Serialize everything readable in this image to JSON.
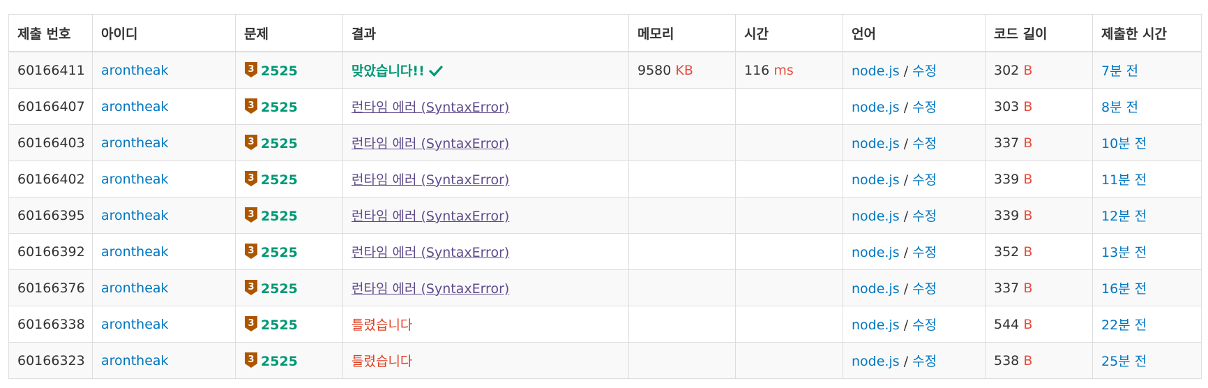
{
  "headers": [
    "제출 번호",
    "아이디",
    "문제",
    "결과",
    "메모리",
    "시간",
    "언어",
    "코드 길이",
    "제출한 시간"
  ],
  "edit_label": "수정",
  "lang_sep": "/",
  "problem_tier": "3",
  "colors": {
    "link_blue": "#0076c0",
    "accepted_green": "#009874",
    "wrong_red": "#dd4124",
    "unit_red": "#e74c3c",
    "runtime_error_purple": "#5f4b8b",
    "bronze_badge": "#ad5600"
  },
  "rows": [
    {
      "id": "60166411",
      "user": "arontheak",
      "problem": "2525",
      "result": "맞았습니다!!",
      "result_type": "accepted",
      "memory": "9580",
      "memory_unit": "KB",
      "time": "116",
      "time_unit": "ms",
      "lang": "node.js",
      "code_len": "302",
      "code_unit": "B",
      "submitted": "7분 전"
    },
    {
      "id": "60166407",
      "user": "arontheak",
      "problem": "2525",
      "result": "런타임 에러 (SyntaxError)",
      "result_type": "rte",
      "memory": "",
      "memory_unit": "",
      "time": "",
      "time_unit": "",
      "lang": "node.js",
      "code_len": "303",
      "code_unit": "B",
      "submitted": "8분 전"
    },
    {
      "id": "60166403",
      "user": "arontheak",
      "problem": "2525",
      "result": "런타임 에러 (SyntaxError)",
      "result_type": "rte",
      "memory": "",
      "memory_unit": "",
      "time": "",
      "time_unit": "",
      "lang": "node.js",
      "code_len": "337",
      "code_unit": "B",
      "submitted": "10분 전"
    },
    {
      "id": "60166402",
      "user": "arontheak",
      "problem": "2525",
      "result": "런타임 에러 (SyntaxError)",
      "result_type": "rte",
      "memory": "",
      "memory_unit": "",
      "time": "",
      "time_unit": "",
      "lang": "node.js",
      "code_len": "339",
      "code_unit": "B",
      "submitted": "11분 전"
    },
    {
      "id": "60166395",
      "user": "arontheak",
      "problem": "2525",
      "result": "런타임 에러 (SyntaxError)",
      "result_type": "rte",
      "memory": "",
      "memory_unit": "",
      "time": "",
      "time_unit": "",
      "lang": "node.js",
      "code_len": "339",
      "code_unit": "B",
      "submitted": "12분 전"
    },
    {
      "id": "60166392",
      "user": "arontheak",
      "problem": "2525",
      "result": "런타임 에러 (SyntaxError)",
      "result_type": "rte",
      "memory": "",
      "memory_unit": "",
      "time": "",
      "time_unit": "",
      "lang": "node.js",
      "code_len": "352",
      "code_unit": "B",
      "submitted": "13분 전"
    },
    {
      "id": "60166376",
      "user": "arontheak",
      "problem": "2525",
      "result": "런타임 에러 (SyntaxError)",
      "result_type": "rte",
      "memory": "",
      "memory_unit": "",
      "time": "",
      "time_unit": "",
      "lang": "node.js",
      "code_len": "337",
      "code_unit": "B",
      "submitted": "16분 전"
    },
    {
      "id": "60166338",
      "user": "arontheak",
      "problem": "2525",
      "result": "틀렸습니다",
      "result_type": "wrong",
      "memory": "",
      "memory_unit": "",
      "time": "",
      "time_unit": "",
      "lang": "node.js",
      "code_len": "544",
      "code_unit": "B",
      "submitted": "22분 전"
    },
    {
      "id": "60166323",
      "user": "arontheak",
      "problem": "2525",
      "result": "틀렸습니다",
      "result_type": "wrong",
      "memory": "",
      "memory_unit": "",
      "time": "",
      "time_unit": "",
      "lang": "node.js",
      "code_len": "538",
      "code_unit": "B",
      "submitted": "25분 전"
    }
  ]
}
